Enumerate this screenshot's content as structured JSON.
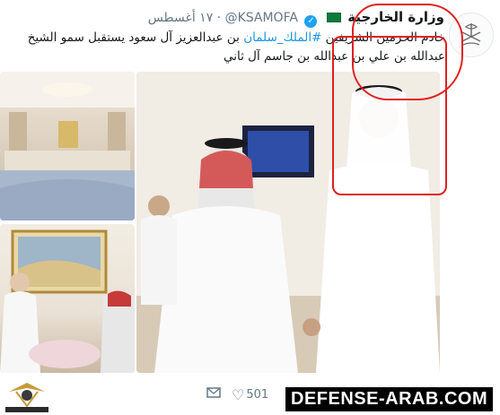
{
  "tweet": {
    "author_name": "وزارة الخارجية",
    "handle": "@KSAMOFA",
    "separator": "·",
    "date": "١٧ أغسطس",
    "text_before": "خادم الحرمين الشريفين ",
    "hashtag": "#الملك_سلمان",
    "text_after": " بن عبدالعزيز آل سعود يستقبل سمو الشيخ عبدالله بن علي بن عبدالله بن جاسم آل ثاني",
    "flag_icon": "saudi-flag-icon",
    "verified_icon": "verified-check-icon"
  },
  "actions": {
    "likes_count": "501"
  },
  "watermark": {
    "text": "DEFENSE-ARAB.COM",
    "logo_text": "ARAB DEFENSE FORUM"
  },
  "colors": {
    "link": "#1b95e0",
    "annotation_red": "#e02020",
    "muted": "#657786"
  }
}
